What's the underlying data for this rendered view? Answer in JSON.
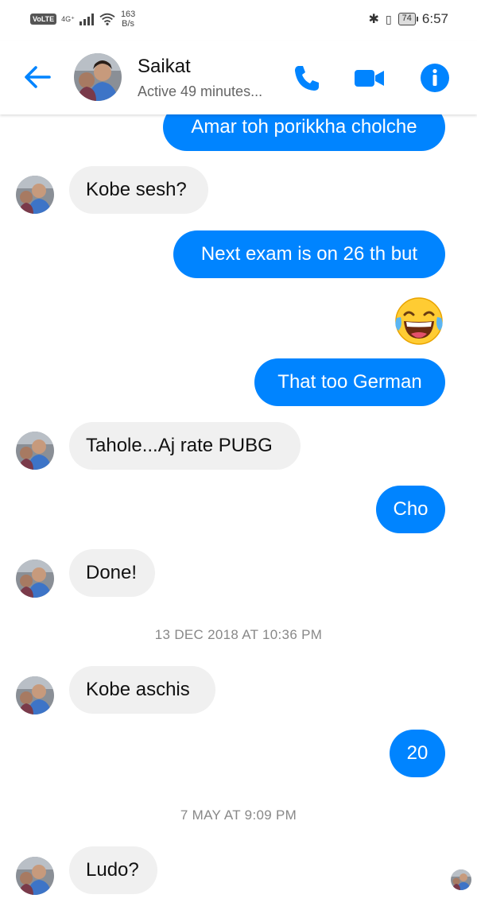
{
  "status_bar": {
    "volte": "VoLTE",
    "network": "4G⁺",
    "net_speed_value": "163",
    "net_speed_unit": "B/s",
    "battery": "74",
    "time": "6:57"
  },
  "header": {
    "contact_name": "Saikat",
    "contact_status": "Active 49 minutes...",
    "accent_color": "#0084ff"
  },
  "messages": [
    {
      "from": "me",
      "text": "Amar toh porikkha cholche"
    },
    {
      "from": "them",
      "text": "Kobe sesh?"
    },
    {
      "from": "me",
      "text": "Next exam is on 26 th but"
    },
    {
      "from": "me",
      "emoji": "face-with-tears-of-joy"
    },
    {
      "from": "me",
      "text": "That too German"
    },
    {
      "from": "them",
      "text": "Tahole...Aj rate PUBG"
    },
    {
      "from": "me",
      "text": "Cho"
    },
    {
      "from": "them",
      "text": "Done!"
    },
    {
      "type": "timestamp",
      "text": "13 DEC 2018 AT 10:36 PM"
    },
    {
      "from": "them",
      "text": "Kobe aschis"
    },
    {
      "from": "me",
      "text": "20"
    },
    {
      "type": "timestamp",
      "text": "7 MAY AT 9:09 PM"
    },
    {
      "from": "them",
      "text": "Ludo?"
    }
  ],
  "colors": {
    "outgoing_bubble": "#0084ff",
    "incoming_bubble": "#f0f0f0",
    "timestamp_text": "#888888"
  }
}
